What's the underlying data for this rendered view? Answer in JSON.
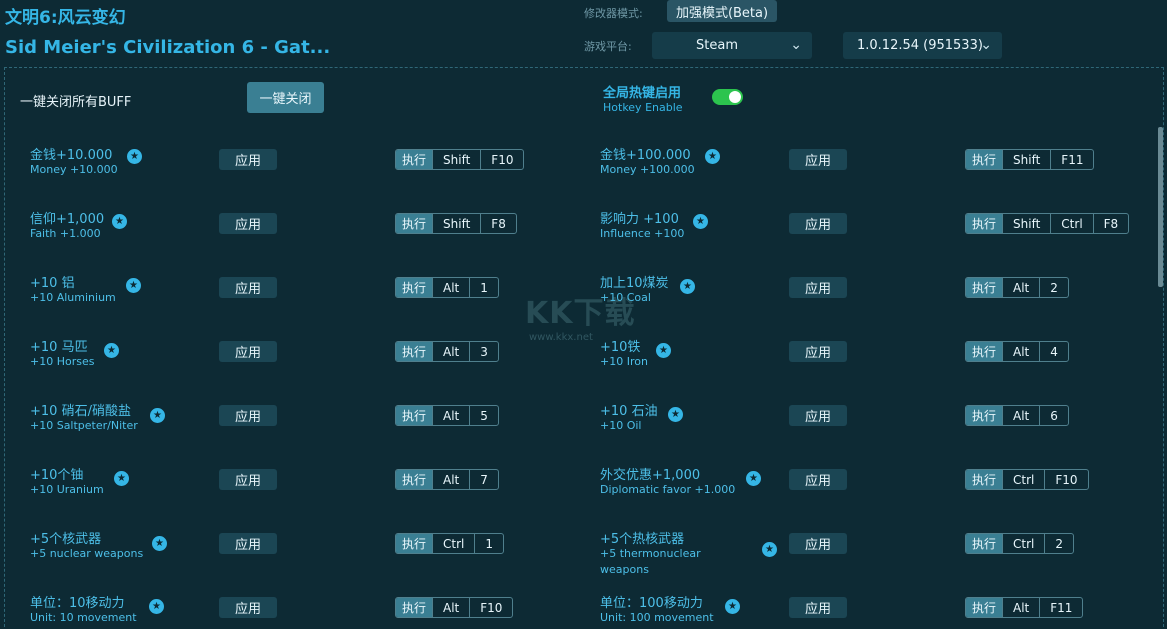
{
  "header": {
    "title_cn": "文明6:风云变幻",
    "title_en": "Sid Meier's Civilization 6 - Gat...",
    "mode_label": "修改器模式:",
    "mode_value": "加强模式(Beta)",
    "platform_label": "游戏平台:",
    "platform_value": "Steam",
    "version_value": "1.0.12.54 (951533)"
  },
  "controls": {
    "close_all_label": "一键关闭所有BUFF",
    "close_all_button": "一键关闭",
    "hotkey_cn": "全局热键启用",
    "hotkey_en": "Hotkey Enable",
    "hotkey_enabled": true,
    "toggle_color": "#2cc44e"
  },
  "cheats": [
    {
      "cn": "金钱+10.000",
      "en": "Money +10.000",
      "apply": "应用",
      "exec": "执行",
      "keys": [
        "Shift",
        "F10"
      ]
    },
    {
      "cn": "金钱+100.000",
      "en": "Money +100.000",
      "apply": "应用",
      "exec": "执行",
      "keys": [
        "Shift",
        "F11"
      ]
    },
    {
      "cn": "信仰+1,000",
      "en": "Faith +1.000",
      "apply": "应用",
      "exec": "执行",
      "keys": [
        "Shift",
        "F8"
      ]
    },
    {
      "cn": "影响力 +100",
      "en": "Influence +100",
      "apply": "应用",
      "exec": "执行",
      "keys": [
        "Shift",
        "Ctrl",
        "F8"
      ]
    },
    {
      "cn": "+10 铝",
      "en": "+10 Aluminium",
      "apply": "应用",
      "exec": "执行",
      "keys": [
        "Alt",
        "1"
      ]
    },
    {
      "cn": "加上10煤炭",
      "en": "+10 Coal",
      "apply": "应用",
      "exec": "执行",
      "keys": [
        "Alt",
        "2"
      ]
    },
    {
      "cn": "+10 马匹",
      "en": "+10 Horses",
      "apply": "应用",
      "exec": "执行",
      "keys": [
        "Alt",
        "3"
      ]
    },
    {
      "cn": "+10铁",
      "en": "+10 Iron",
      "apply": "应用",
      "exec": "执行",
      "keys": [
        "Alt",
        "4"
      ]
    },
    {
      "cn": "+10 硝石/硝酸盐",
      "en": "+10 Saltpeter/Niter",
      "apply": "应用",
      "exec": "执行",
      "keys": [
        "Alt",
        "5"
      ]
    },
    {
      "cn": "+10 石油",
      "en": "+10 Oil",
      "apply": "应用",
      "exec": "执行",
      "keys": [
        "Alt",
        "6"
      ]
    },
    {
      "cn": "+10个铀",
      "en": "+10 Uranium",
      "apply": "应用",
      "exec": "执行",
      "keys": [
        "Alt",
        "7"
      ]
    },
    {
      "cn": "外交优惠+1,000",
      "en": "Diplomatic favor +1.000",
      "apply": "应用",
      "exec": "执行",
      "keys": [
        "Ctrl",
        "F10"
      ]
    },
    {
      "cn": "+5个核武器",
      "en": "+5 nuclear weapons",
      "apply": "应用",
      "exec": "执行",
      "keys": [
        "Ctrl",
        "1"
      ]
    },
    {
      "cn": "+5个热核武器",
      "en": "+5 thermonuclear weapons",
      "apply": "应用",
      "exec": "执行",
      "keys": [
        "Ctrl",
        "2"
      ]
    },
    {
      "cn": "单位：10移动力",
      "en": "Unit: 10 movement",
      "apply": "应用",
      "exec": "执行",
      "keys": [
        "Alt",
        "F10"
      ]
    },
    {
      "cn": "单位：100移动力",
      "en": "Unit: 100 movement",
      "apply": "应用",
      "exec": "执行",
      "keys": [
        "Alt",
        "F11"
      ]
    }
  ],
  "watermark": {
    "text": "KK下载",
    "url": "www.kkx.net"
  }
}
